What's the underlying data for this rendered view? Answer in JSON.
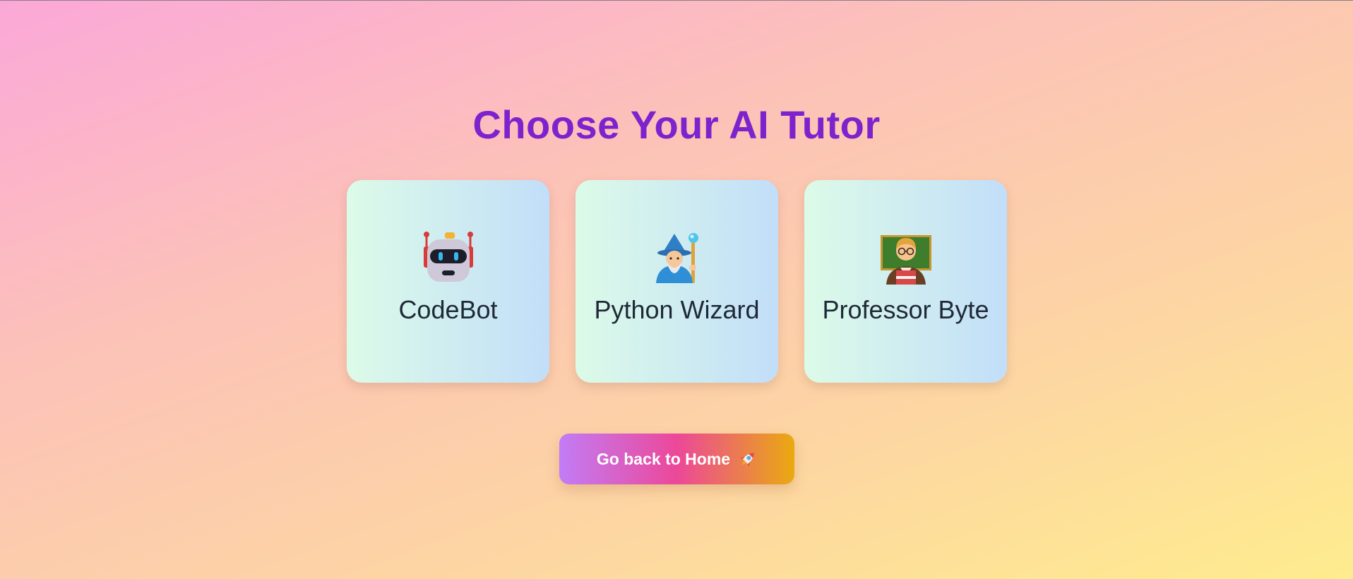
{
  "page": {
    "title": "Choose Your AI Tutor"
  },
  "tutors": [
    {
      "name": "CodeBot",
      "icon": "robot-icon"
    },
    {
      "name": "Python Wizard",
      "icon": "wizard-icon"
    },
    {
      "name": "Professor Byte",
      "icon": "teacher-icon"
    }
  ],
  "actions": {
    "home_label": "Go back to Home",
    "home_icon": "rocket-icon"
  },
  "colors": {
    "title": "#7e22ce",
    "card_gradient": [
      "#dcfbe8",
      "#c2def9"
    ],
    "button_gradient": [
      "#c27cf6",
      "#ec4899",
      "#eaaa10"
    ]
  }
}
